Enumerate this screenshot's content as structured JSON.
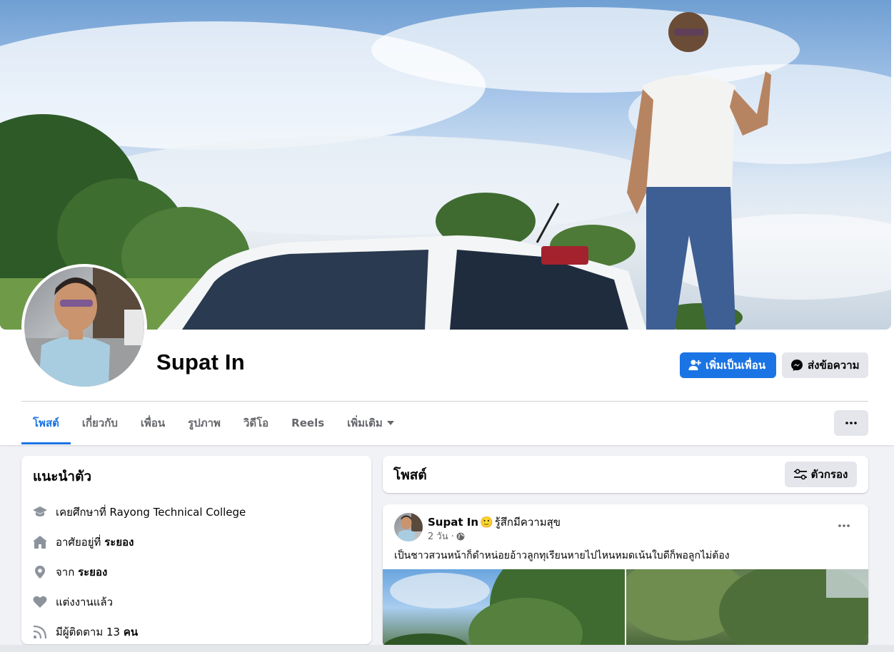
{
  "profile": {
    "name": "Supat In",
    "add_friend_label": "เพิ่มเป็นเพื่อน",
    "message_label": "ส่งข้อความ"
  },
  "tabs": [
    {
      "label": "โพสต์",
      "active": true
    },
    {
      "label": "เกี่ยวกับ",
      "active": false
    },
    {
      "label": "เพื่อน",
      "active": false
    },
    {
      "label": "รูปภาพ",
      "active": false
    },
    {
      "label": "วิดีโอ",
      "active": false
    },
    {
      "label": "Reels",
      "active": false
    },
    {
      "label": "เพิ่มเติม",
      "active": false
    }
  ],
  "intro": {
    "title": "แนะนำตัว",
    "items": [
      {
        "icon": "graduation-cap-icon",
        "prefix": "เคยศึกษาที่ Rayong Technical College",
        "bold": ""
      },
      {
        "icon": "home-icon",
        "prefix": "อาศัยอยู่ที่ ",
        "bold": "ระยอง"
      },
      {
        "icon": "location-pin-icon",
        "prefix": "จาก ",
        "bold": "ระยอง"
      },
      {
        "icon": "heart-icon",
        "prefix": "แต่งงานแล้ว",
        "bold": ""
      },
      {
        "icon": "rss-icon",
        "prefix": "มีผู้ติดตาม 13 ",
        "bold": "คน"
      }
    ]
  },
  "posts_section": {
    "title": "โพสต์",
    "filter_label": "ตัวกรอง"
  },
  "post": {
    "author": "Supat In",
    "feeling_emoji": "🙂",
    "feeling": "รู้สึกมีความสุข",
    "time": "2 วัน ·",
    "text": "เป็นชาวสวนหน้าก็ดำหน่อยอ้าวลูกทุเรียนหายไปไหนหมดเน้นใบดีก็พอลูกไม่ต้อง"
  },
  "colors": {
    "accent": "#1b74e4",
    "button_gray": "#e4e6eb",
    "background": "#f0f2f5",
    "secondary_text": "#65676b"
  }
}
